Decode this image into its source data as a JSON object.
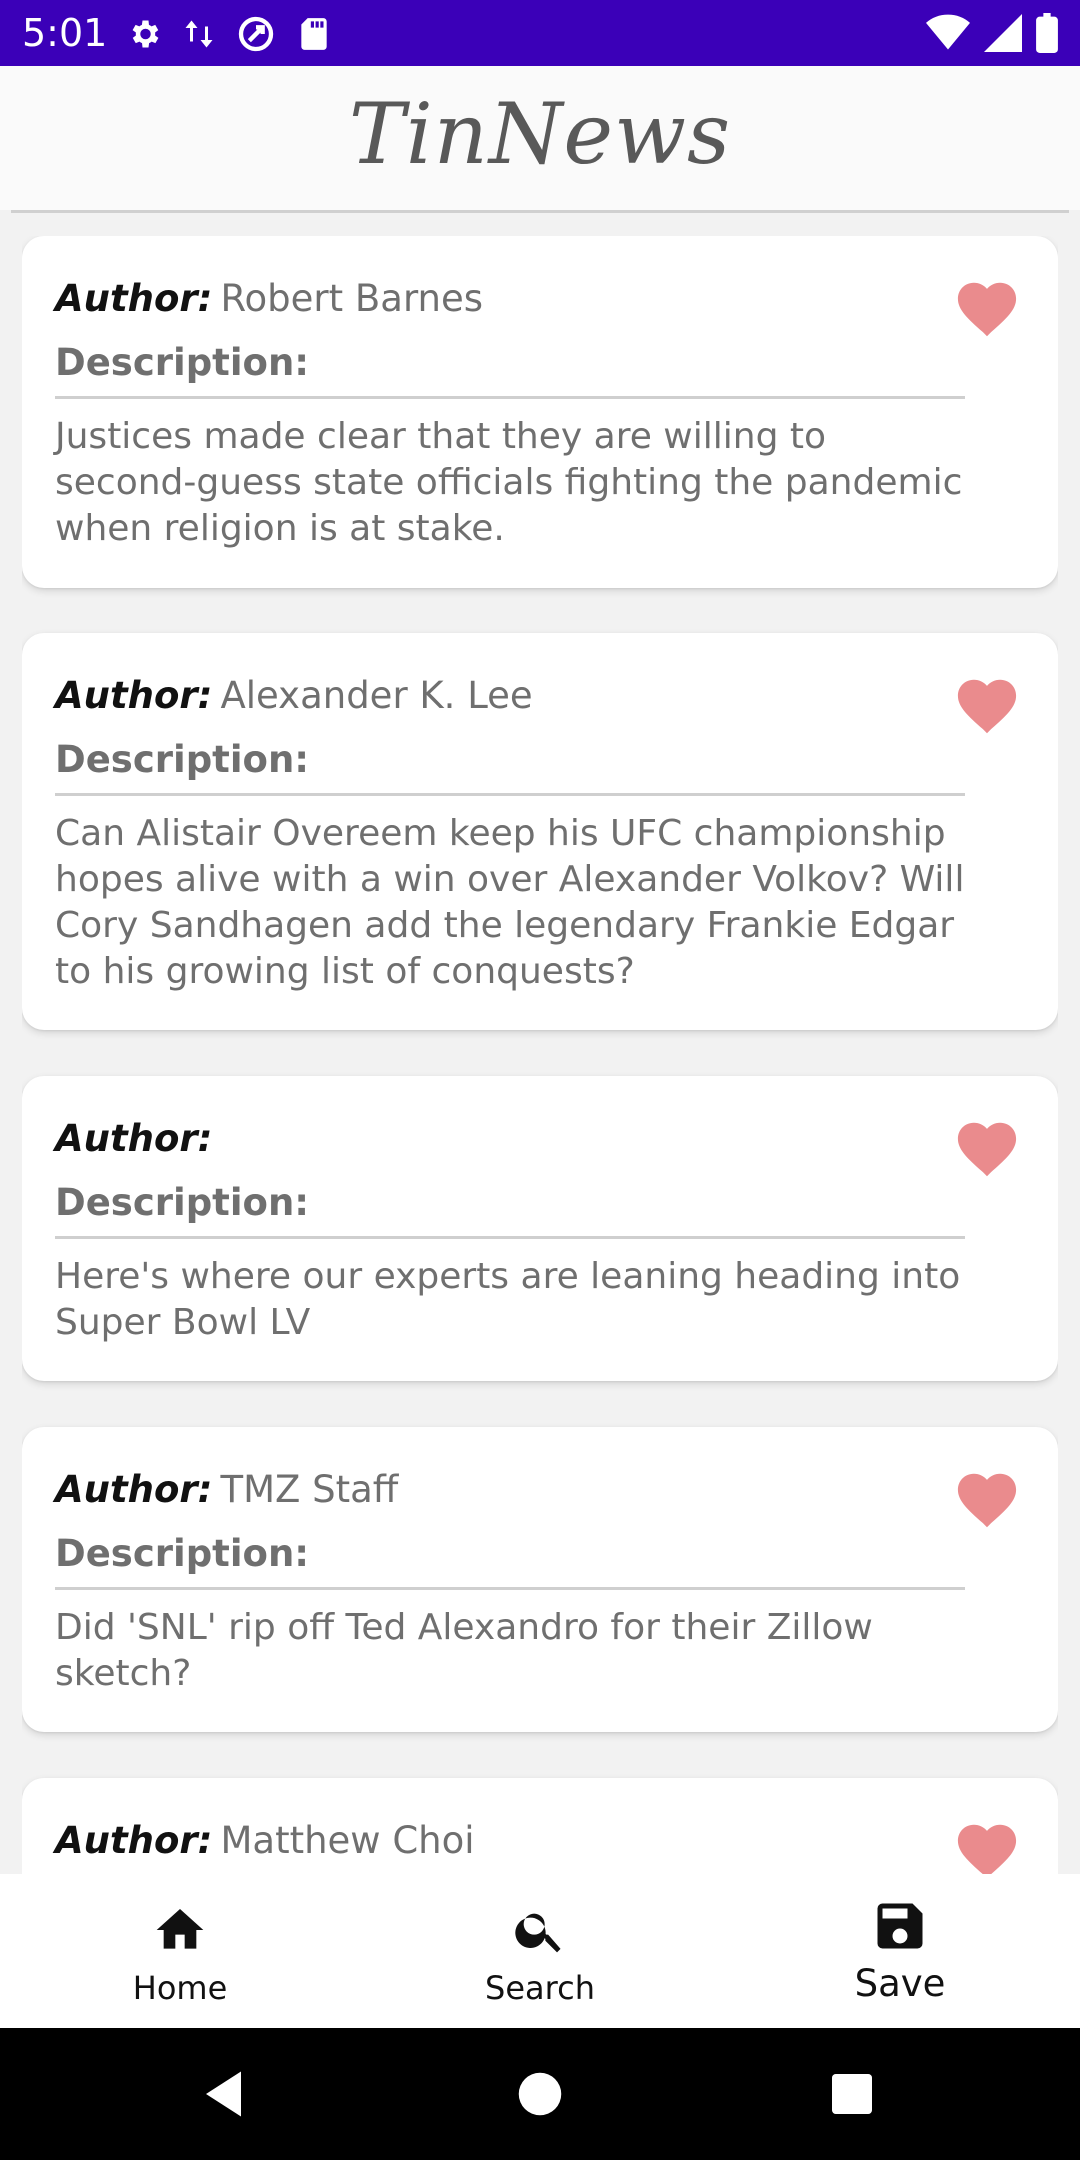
{
  "status_bar": {
    "time": "5:01",
    "left_icons": [
      "settings-icon",
      "data-transfer-icon",
      "vpn-icon",
      "sd-card-icon"
    ],
    "right_icons": [
      "wifi-icon",
      "signal-icon",
      "battery-icon"
    ],
    "color": "#3b00b8"
  },
  "app_bar": {
    "title": "TinNews"
  },
  "feed": {
    "author_label": "Author:",
    "description_label": "Description:",
    "favorite_color": "#ea8b8d",
    "items": [
      {
        "author": "Robert Barnes",
        "description": "Justices made clear that they are willing to second-guess state officials fighting the pandemic when religion is at stake."
      },
      {
        "author": "Alexander K. Lee",
        "description": "Can Alistair Overeem keep his UFC championship hopes alive with a win over Alexander Volkov? Will Cory Sandhagen add the legendary Frankie Edgar to his growing list of conquests?"
      },
      {
        "author": "",
        "description": "Here's where our experts are leaning heading into Super Bowl LV"
      },
      {
        "author": "TMZ Staff",
        "description": "Did 'SNL' rip off Ted Alexandro for their Zillow sketch?"
      },
      {
        "author": "Matthew Choi",
        "description": ""
      }
    ]
  },
  "bottom_nav": {
    "items": [
      {
        "label": "Home",
        "icon": "home-icon"
      },
      {
        "label": "Search",
        "icon": "search-icon"
      },
      {
        "label": "Save",
        "icon": "save-icon"
      }
    ],
    "active": "Save"
  },
  "system_nav": {
    "buttons": [
      "back-icon",
      "home-circle-icon",
      "recents-icon"
    ]
  }
}
